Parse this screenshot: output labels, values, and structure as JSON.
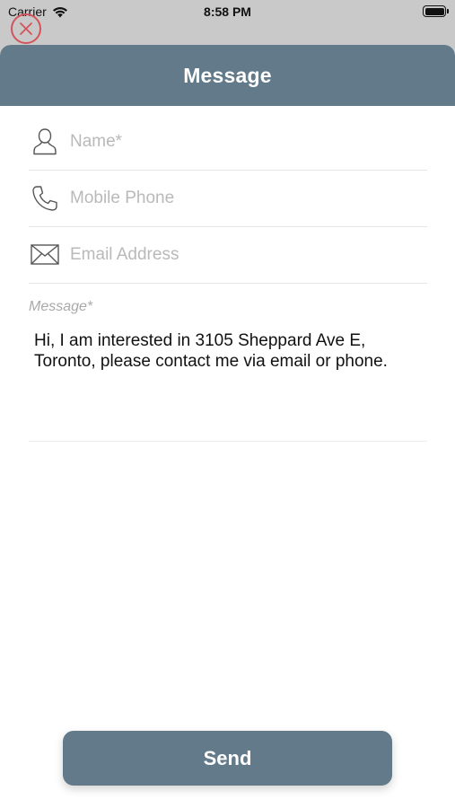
{
  "status_bar": {
    "carrier": "Carrier",
    "time": "8:58 PM"
  },
  "header": {
    "title": "Message"
  },
  "form": {
    "name": {
      "value": "",
      "placeholder": "Name*"
    },
    "phone": {
      "value": "",
      "placeholder": "Mobile Phone"
    },
    "email": {
      "value": "",
      "placeholder": "Email Address"
    },
    "message": {
      "label": "Message*",
      "value": "Hi, I am interested in 3105 Sheppard Ave E, Toronto, please contact me via email or phone."
    }
  },
  "actions": {
    "send_label": "Send"
  },
  "icons": {
    "close": "close-icon",
    "name": "person-icon",
    "phone": "phone-icon",
    "email": "envelope-icon"
  },
  "colors": {
    "accent": "#627a89",
    "close": "#d2545a",
    "placeholder": "#b9b9b9"
  }
}
